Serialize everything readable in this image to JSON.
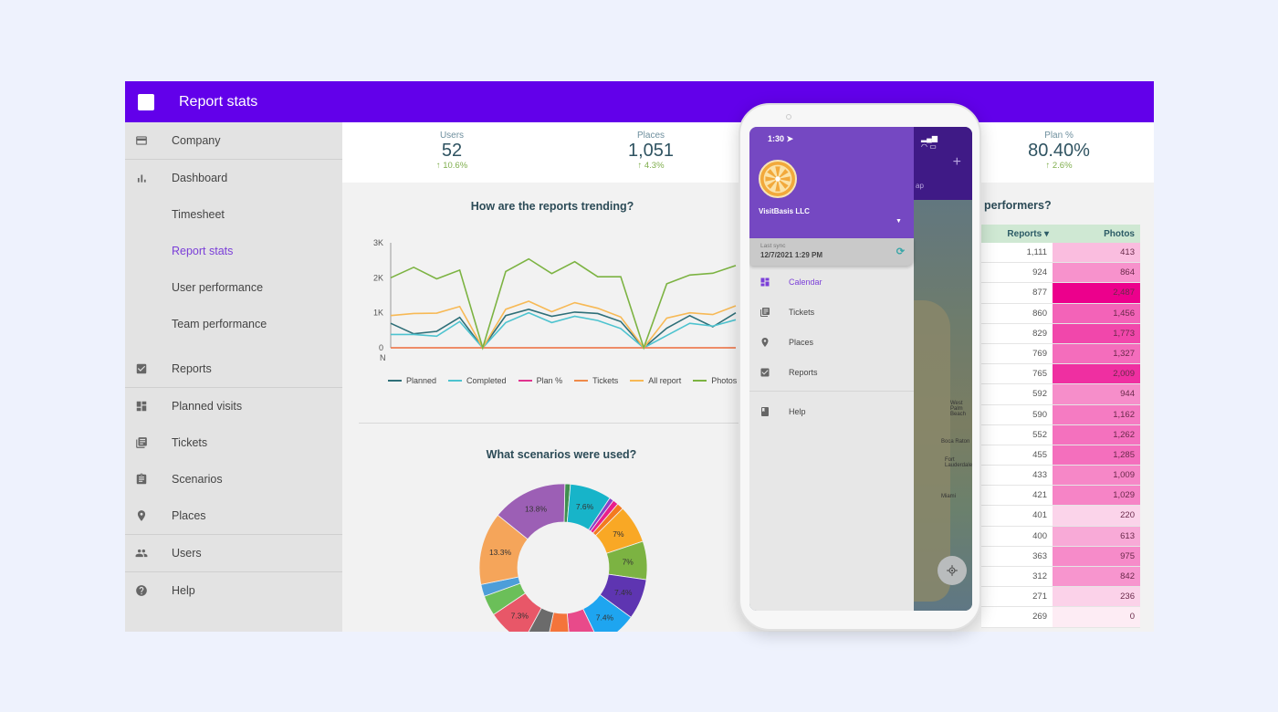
{
  "app": {
    "title": "Report stats"
  },
  "sidebar": {
    "items": [
      {
        "label": "Company",
        "icon": "card-icon"
      },
      {
        "label": "Dashboard",
        "icon": "bar-chart-icon"
      },
      {
        "label": "Timesheet"
      },
      {
        "label": "Report stats",
        "active": true
      },
      {
        "label": "User performance"
      },
      {
        "label": "Team performance"
      },
      {
        "label": "Reports",
        "icon": "checked-clipboard-icon"
      },
      {
        "label": "Planned visits",
        "icon": "dashboard-grid-icon"
      },
      {
        "label": "Tickets",
        "icon": "tickets-icon"
      },
      {
        "label": "Scenarios",
        "icon": "clipboard-list-icon"
      },
      {
        "label": "Places",
        "icon": "map-pin-icon"
      },
      {
        "label": "Users",
        "icon": "people-icon"
      },
      {
        "label": "Help",
        "icon": "help-icon"
      }
    ]
  },
  "kpis": [
    {
      "label": "Users",
      "value": "52",
      "delta": "↑ 10.6%"
    },
    {
      "label": "Places",
      "value": "1,051",
      "delta": "↑ 4.3%"
    },
    {
      "label": "Plan %",
      "value": "80.40%",
      "delta": "↑ 2.6%"
    }
  ],
  "colors": {
    "brand": "#6200ea",
    "accent": "#7b3fd8",
    "positive": "#7fae4d"
  },
  "chart_data": [
    {
      "type": "line",
      "title": "How are the reports trending?",
      "xlabel": "",
      "ylabel": "",
      "x_tick_first": "N",
      "yticks": [
        "0",
        "1K",
        "2K",
        "3K"
      ],
      "ylim": [
        0,
        3000
      ],
      "grid": false,
      "legend_position": "bottom",
      "x": [
        1,
        2,
        3,
        4,
        5,
        6,
        7,
        8,
        9,
        10,
        11,
        12,
        13,
        14,
        15,
        16,
        17,
        18,
        19,
        20
      ],
      "series": [
        {
          "name": "Planned",
          "color": "#2f6f78",
          "values": [
            700,
            400,
            470,
            870,
            0,
            920,
            1100,
            900,
            1020,
            980,
            750,
            0,
            560,
            920,
            600,
            1000
          ]
        },
        {
          "name": "Completed",
          "color": "#4dc3cf",
          "values": [
            380,
            380,
            330,
            750,
            0,
            720,
            1000,
            720,
            900,
            780,
            550,
            0,
            350,
            700,
            620,
            800
          ]
        },
        {
          "name": "Plan %",
          "color": "#e0338f",
          "values": [
            0,
            0,
            0,
            0,
            0,
            0,
            0,
            0,
            0,
            0,
            0,
            0,
            0,
            0,
            0,
            0
          ]
        },
        {
          "name": "Tickets",
          "color": "#ef8a4a",
          "values": [
            0,
            0,
            0,
            0,
            0,
            0,
            0,
            0,
            0,
            0,
            0,
            0,
            0,
            0,
            0,
            0
          ]
        },
        {
          "name": "All report",
          "color": "#f7b955",
          "values": [
            920,
            980,
            990,
            1180,
            0,
            1100,
            1330,
            1030,
            1290,
            1130,
            880,
            0,
            850,
            1000,
            950,
            1200
          ]
        },
        {
          "name": "Photos",
          "color": "#7cb342",
          "values": [
            2000,
            2300,
            1970,
            2220,
            0,
            2180,
            2540,
            2120,
            2460,
            2030,
            2030,
            0,
            1830,
            2080,
            2130,
            2350
          ]
        }
      ]
    },
    {
      "type": "pie",
      "title": "What scenarios were used?",
      "donut": true,
      "slices": [
        {
          "label": "",
          "value": 1.0,
          "color": "#3f8f4f"
        },
        {
          "label": "7.6%",
          "value": 7.6,
          "color": "#17b4c9"
        },
        {
          "label": "",
          "value": 0.8,
          "color": "#8b3fc9"
        },
        {
          "label": "",
          "value": 1.0,
          "color": "#e91e8c"
        },
        {
          "label": "",
          "value": 1.2,
          "color": "#f47a20"
        },
        {
          "label": "7%",
          "value": 7.0,
          "color": "#f9a825"
        },
        {
          "label": "7%",
          "value": 7.0,
          "color": "#7cb342"
        },
        {
          "label": "7.4%",
          "value": 7.4,
          "color": "#5e35b1"
        },
        {
          "label": "7.4%",
          "value": 7.4,
          "color": "#1ea5f0"
        },
        {
          "label": "",
          "value": 5.5,
          "color": "#e84a8a"
        },
        {
          "label": "",
          "value": 4.5,
          "color": "#f4743b"
        },
        {
          "label": "",
          "value": 4.3,
          "color": "#6b6b6b"
        },
        {
          "label": "7.3%",
          "value": 7.3,
          "color": "#e85768"
        },
        {
          "label": "",
          "value": 3.7,
          "color": "#6bbf59"
        },
        {
          "label": "",
          "value": 2.2,
          "color": "#4d9ed9"
        },
        {
          "label": "13.3%",
          "value": 13.3,
          "color": "#f5a55a"
        },
        {
          "label": "13.8%",
          "value": 13.8,
          "color": "#9c5fb5"
        }
      ]
    }
  ],
  "performers": {
    "title": "performers?",
    "columns": [
      "Reports ▾",
      "Photos"
    ],
    "rows": [
      {
        "reports": "1,111",
        "photos": "413",
        "intensity": 0.2
      },
      {
        "reports": "924",
        "photos": "864",
        "intensity": 0.38
      },
      {
        "reports": "877",
        "photos": "2,487",
        "intensity": 1.0
      },
      {
        "reports": "860",
        "photos": "1,456",
        "intensity": 0.58
      },
      {
        "reports": "829",
        "photos": "1,773",
        "intensity": 0.7
      },
      {
        "reports": "769",
        "photos": "1,327",
        "intensity": 0.54
      },
      {
        "reports": "765",
        "photos": "2,009",
        "intensity": 0.8
      },
      {
        "reports": "592",
        "photos": "944",
        "intensity": 0.4
      },
      {
        "reports": "590",
        "photos": "1,162",
        "intensity": 0.48
      },
      {
        "reports": "552",
        "photos": "1,262",
        "intensity": 0.52
      },
      {
        "reports": "455",
        "photos": "1,285",
        "intensity": 0.53
      },
      {
        "reports": "433",
        "photos": "1,009",
        "intensity": 0.43
      },
      {
        "reports": "421",
        "photos": "1,029",
        "intensity": 0.44
      },
      {
        "reports": "401",
        "photos": "220",
        "intensity": 0.1
      },
      {
        "reports": "400",
        "photos": "613",
        "intensity": 0.28
      },
      {
        "reports": "363",
        "photos": "975",
        "intensity": 0.41
      },
      {
        "reports": "312",
        "photos": "842",
        "intensity": 0.37
      },
      {
        "reports": "271",
        "photos": "236",
        "intensity": 0.11
      },
      {
        "reports": "269",
        "photos": "0",
        "intensity": 0.0
      }
    ]
  },
  "phone": {
    "status_time": "1:30 ➤",
    "status_icons": "▂▄▆ ◠ ▭",
    "org_name": "VisitBasis LLC",
    "sync_label": "Last sync",
    "sync_time": "12/7/2021 1:29 PM",
    "map_tab": "ap",
    "menu": [
      {
        "label": "Calendar",
        "active": true
      },
      {
        "label": "Tickets"
      },
      {
        "label": "Places"
      },
      {
        "label": "Reports"
      },
      {
        "label": "Help"
      }
    ],
    "map_labels": [
      "West Palm Beach",
      "Boca Raton",
      "Fort Lauderdale",
      "Miami"
    ]
  }
}
